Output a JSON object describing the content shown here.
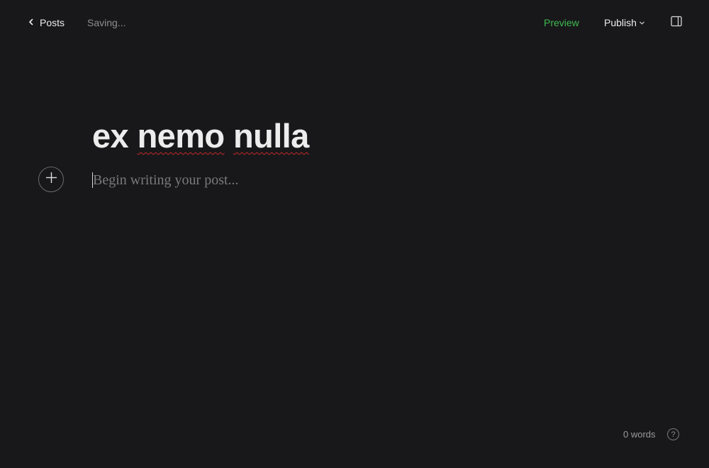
{
  "header": {
    "back_label": "Posts",
    "status": "Saving...",
    "preview_label": "Preview",
    "publish_label": "Publish"
  },
  "icons": {
    "back": "chevron-left-icon",
    "publish_menu": "chevron-down-icon",
    "settings_panel": "sidebar-panel-icon",
    "add_card": "plus-icon",
    "help": "question-icon"
  },
  "editor": {
    "title_words": [
      "ex",
      "nemo",
      "nulla"
    ],
    "body_placeholder": "Begin writing your post..."
  },
  "footer": {
    "word_count": "0 words",
    "help_glyph": "?"
  },
  "colors": {
    "background": "#18181a",
    "accent": "#3fb950",
    "spellcheck": "#c62828"
  }
}
